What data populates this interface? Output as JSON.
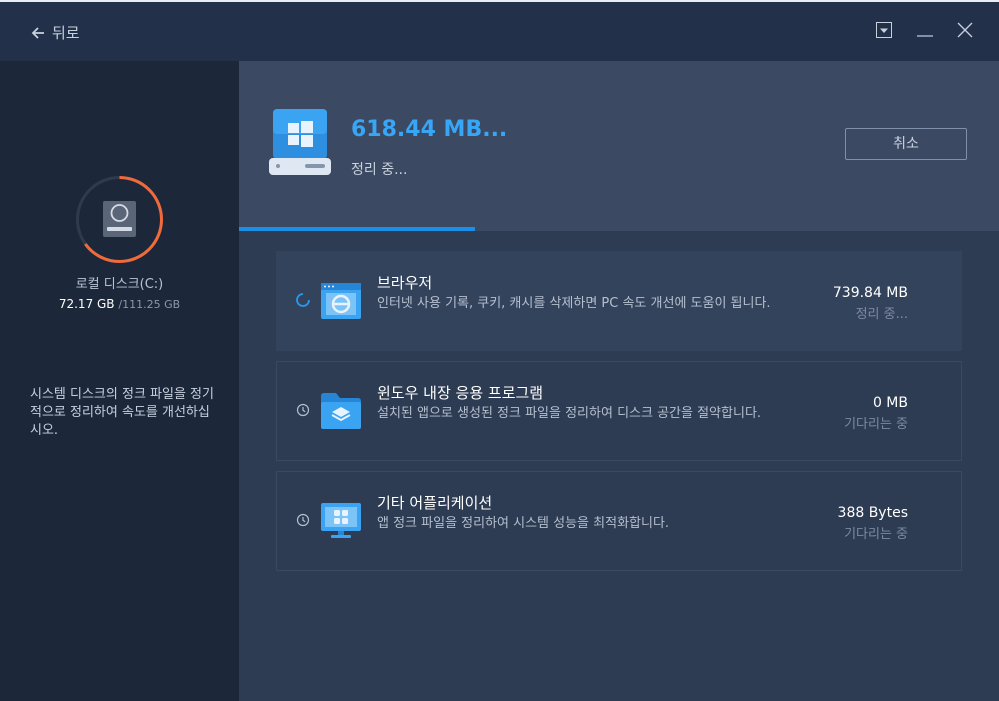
{
  "titlebar": {
    "back_label": "뒤로"
  },
  "sidebar": {
    "disk_name": "로컬 디스크(C:)",
    "disk_used": "72.17 GB",
    "disk_total": "/111.25 GB",
    "disk_usage_fraction": 0.65,
    "description": "시스템 디스크의 정크 파일을 정기적으로 정리하여 속도를 개선하십시오."
  },
  "header": {
    "size": "618.44 MB...",
    "status": "정리 중...",
    "cancel_label": "취소",
    "progress_fraction": 0.31
  },
  "items": [
    {
      "title": "브라우저",
      "description": "인터넷 사용 기록, 쿠키, 캐시를 삭제하면 PC 속도 개선에 도움이 됩니다.",
      "size": "739.84 MB",
      "status": "정리 중...",
      "icon": "browser-icon",
      "state": "cleaning"
    },
    {
      "title": "윈도우 내장 응용 프로그램",
      "description": "설치된 앱으로 생성된 정크 파일을 정리하여 디스크 공간을 절약합니다.",
      "size": "0 MB",
      "status": "기다리는 중",
      "icon": "windows-apps-folder-icon",
      "state": "waiting"
    },
    {
      "title": "기타 어플리케이션",
      "description": "앱 정크 파일을 정리하여 시스템 성능을 최적화합니다.",
      "size": "388 Bytes",
      "status": "기다리는 중",
      "icon": "other-apps-icon",
      "state": "waiting"
    }
  ],
  "colors": {
    "accent": "#38a6f6",
    "progress": "#1a8fe8",
    "ring": "#f06a3a"
  }
}
